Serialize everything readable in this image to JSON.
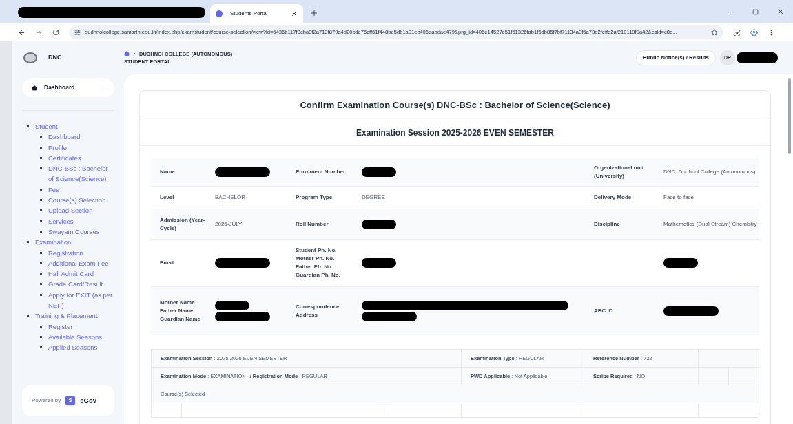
{
  "browser": {
    "tabs": [
      {
        "kind": "redacted",
        "selected": false
      },
      {
        "kind": "page",
        "title": "- Students Portal",
        "selected": true
      }
    ],
    "url": "dudhnoicollege.samarth.edu.in/index.php/examstudent/course-selection/view?id=6436b117f8cba3f2a713f879a4d20cde75cff61f448be5db1a01ec406eabdae479&prg_id=406e14527e51f51326fab1f6db85f7bf71134a0f6a73d2feffe2af210119f9a42&esid=c8e..."
  },
  "sidebar": {
    "brand": "DNC",
    "dashboard": "Dashboard",
    "menu": [
      {
        "label": "Student",
        "children": [
          {
            "label": "Dashboard"
          },
          {
            "label": "Profile"
          },
          {
            "label": "Certificates"
          },
          {
            "label": "DNC-BSc : Bachelor of Science(Science)"
          },
          {
            "label": "Fee"
          },
          {
            "label": "Course(s) Selection"
          },
          {
            "label": "Upload Section"
          },
          {
            "label": "Services"
          },
          {
            "label": "Swayam Courses"
          }
        ]
      },
      {
        "label": "Examination",
        "children": [
          {
            "label": "Registration"
          },
          {
            "label": "Additional Exam Fee"
          },
          {
            "label": "Hall Admit Card"
          },
          {
            "label": "Grade Card/Result"
          },
          {
            "label": "Apply for EXIT (as per NEP)"
          }
        ]
      },
      {
        "label": "Training & Placement",
        "children": [
          {
            "label": "Register"
          },
          {
            "label": "Available Seasons"
          },
          {
            "label": "Applied Seasons"
          }
        ]
      }
    ],
    "powered_by": "Powered by",
    "egov_badge": "S",
    "egov": "eGov"
  },
  "header": {
    "breadcrumb": "DUDHNOI COLLEGE (AUTONOMOUS)",
    "subtitle": "STUDENT PORTAL",
    "notice_button": "Public Notice(s) / Results",
    "avatar": "DR"
  },
  "card": {
    "title": "Confirm Examination Course(s) DNC-BSc : Bachelor of Science(Science)",
    "session": "Examination Session 2025-2026 EVEN SEMESTER"
  },
  "info_rows": [
    {
      "cells": [
        {
          "label": [
            "Name"
          ],
          "value": [
            {
              "kind": "redacted_long"
            }
          ]
        },
        {
          "label": [
            "Enrolment Number"
          ],
          "value": [
            {
              "kind": "redacted"
            }
          ]
        },
        {
          "label": [
            "Organizational unit (University)"
          ],
          "value": [
            {
              "kind": "text",
              "text": "DNC: Dudhnoi College (Autonomous)"
            }
          ]
        }
      ]
    },
    {
      "cells": [
        {
          "label": [
            "Level"
          ],
          "value": [
            {
              "kind": "text",
              "text": "BACHELOR"
            }
          ]
        },
        {
          "label": [
            "Program Type"
          ],
          "value": [
            {
              "kind": "text",
              "text": "DEGREE"
            }
          ]
        },
        {
          "label": [
            "Delivery Mode"
          ],
          "value": [
            {
              "kind": "text",
              "text": "Face to face"
            }
          ]
        }
      ]
    },
    {
      "cells": [
        {
          "label": [
            "Admission (Year-Cycle)"
          ],
          "value": [
            {
              "kind": "text",
              "text": "2025-JULY"
            }
          ]
        },
        {
          "label": [
            "Roll Number"
          ],
          "value": [
            {
              "kind": "redacted"
            }
          ]
        },
        {
          "label": [
            "Discipline"
          ],
          "value": [
            {
              "kind": "text",
              "text": "Mathematics (Dual Stream) Chemistry"
            }
          ]
        }
      ]
    },
    {
      "cells": [
        {
          "label": [
            "Email"
          ],
          "value": [
            {
              "kind": "redacted_long"
            }
          ]
        },
        {
          "label": [
            "Student Ph. No.",
            "Mother Ph. No.",
            "Father Ph. No.",
            "Guardian Ph. No."
          ],
          "value": [
            {
              "kind": "redacted"
            }
          ]
        },
        {
          "value": [
            {
              "kind": "redacted"
            }
          ]
        }
      ]
    },
    {
      "cells": [
        {
          "label": [
            "Mother Name",
            "Father Name",
            "Guardian Name"
          ],
          "value": [
            {
              "kind": "redacted"
            },
            {
              "kind": "redacted_long"
            }
          ]
        },
        {
          "label": [
            "Correspondence Address"
          ],
          "value": [
            {
              "kind": "redacted_wide"
            },
            {
              "kind": "redacted_long"
            }
          ]
        },
        {
          "label": [
            "ABC ID"
          ],
          "value": [
            {
              "kind": "redacted_long"
            }
          ]
        }
      ]
    }
  ],
  "exam_rows": [
    {
      "cells": [
        {
          "pairs": [
            {
              "label": "Examination Session",
              "separator": ":",
              "value": "2025-2026 EVEN SEMESTER"
            }
          ]
        },
        {
          "pairs": [
            {
              "label": "Examination Type",
              "separator": ":",
              "value": "REGULAR"
            }
          ]
        },
        {
          "pairs": [
            {
              "label": "Reference Number",
              "separator": ":",
              "value": "732"
            }
          ]
        }
      ]
    },
    {
      "cells": [
        {
          "pairs": [
            {
              "label": "Examination Mode",
              "separator": ":",
              "value": "EXAMINATION"
            },
            {
              "label": "/ Registration Mode",
              "separator": ":",
              "value": "REGULAR"
            }
          ]
        },
        {
          "pairs": [
            {
              "label": "PWD Applicable",
              "separator": ":",
              "value": "Not Applicable"
            }
          ]
        },
        {
          "pairs": [
            {
              "label": "Scribe Required",
              "separator": ":",
              "value": "NO"
            }
          ]
        }
      ]
    }
  ],
  "courses_heading": "Course(s) Selected"
}
